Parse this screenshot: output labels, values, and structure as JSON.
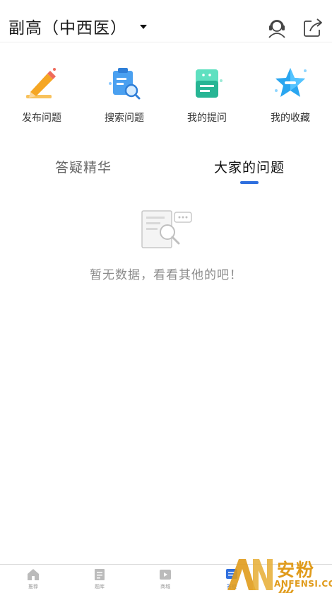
{
  "header": {
    "title": "副高（中西医）",
    "icons": [
      "customer-service-icon",
      "share-icon"
    ]
  },
  "shortcuts": [
    {
      "label": "发布问题",
      "icon": "pencil-icon"
    },
    {
      "label": "搜索问题",
      "icon": "search-clipboard-icon"
    },
    {
      "label": "我的提问",
      "icon": "chat-note-icon"
    },
    {
      "label": "我的收藏",
      "icon": "star-icon"
    }
  ],
  "tabs": [
    {
      "label": "答疑精华",
      "active": false
    },
    {
      "label": "大家的问题",
      "active": true
    }
  ],
  "empty_state": {
    "message": "暂无数据，看看其他的吧！",
    "icon": "empty-search-icon"
  },
  "bottom_nav": [
    {
      "label": "推荐",
      "icon": "home-icon"
    },
    {
      "label": "题库",
      "icon": "question-bank-icon"
    },
    {
      "label": "商城",
      "icon": "play-icon"
    },
    {
      "label": "答疑",
      "icon": "qa-icon"
    }
  ],
  "watermark": {
    "logo": "AN",
    "text": "安粉丝",
    "sub": "ANFENSI.COM"
  },
  "colors": {
    "accent": "#2f6fde",
    "pencil": "#f5b13c",
    "search": "#4aa0f0",
    "chat": "#3cc6a7",
    "star": "#2aa6f0",
    "empty_text": "#8c8c8c",
    "watermark": "#e09b1b"
  }
}
